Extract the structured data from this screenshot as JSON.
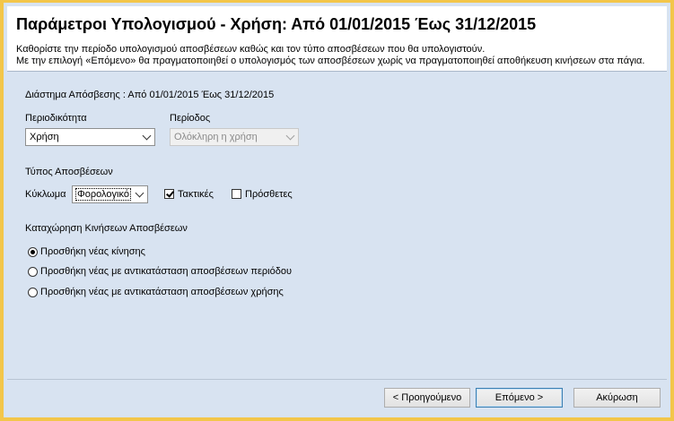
{
  "header": {
    "title": "Παράμετροι Υπολογισμού - Χρήση: Από 01/01/2015 Έως 31/12/2015",
    "desc_line1": "Καθορίστε την περίοδο υπολογισμού αποσβέσεων καθώς και τον τύπο αποσβέσεων που θα υπολογιστούν.",
    "desc_line2": "Με την επιλογή «Επόμενο» θα πραγματοποιηθεί ο υπολογισμός των αποσβέσεων χωρίς να πραγματοποιηθεί αποθήκευση κινήσεων στα πάγια."
  },
  "range_label": "Διάστημα Απόσβεσης : Από 01/01/2015 Έως 31/12/2015",
  "periodicity": {
    "label": "Περιοδικότητα",
    "value": "Χρήση"
  },
  "period": {
    "label": "Περίοδος",
    "value": "Ολόκληρη η χρήση"
  },
  "depreciation_type": {
    "label": "Τύπος Αποσβέσεων",
    "cycle_label": "Κύκλωμα",
    "cycle_value": "Φορολογικό",
    "regular_label": "Τακτικές",
    "regular_checked": true,
    "additional_label": "Πρόσθετες",
    "additional_checked": false
  },
  "movements": {
    "label": "Καταχώρηση Κινήσεων Αποσβέσεων",
    "options": [
      {
        "label": "Προσθήκη νέας κίνησης",
        "selected": true
      },
      {
        "label": "Προσθήκη νέας με αντικατάσταση αποσβέσεων περιόδου",
        "selected": false
      },
      {
        "label": "Προσθήκη νέας με αντικατάσταση αποσβέσεων χρήσης",
        "selected": false
      }
    ]
  },
  "buttons": {
    "previous": "< Προηγούμενο",
    "next": "Επόμενο >",
    "cancel": "Ακύρωση"
  },
  "colors": {
    "frame": "#f3c64a",
    "panel": "#d8e3f1",
    "header_bg": "#ffffff"
  }
}
